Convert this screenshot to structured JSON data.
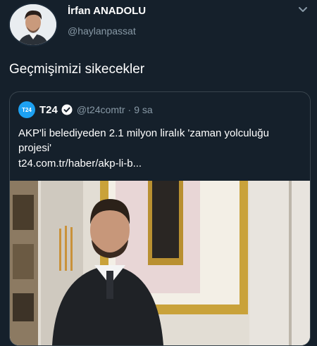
{
  "tweet": {
    "author_name": "İrfan ANADOLU",
    "author_handle": "@haylanpassat",
    "text": "Geçmişimizi sikecekler"
  },
  "quote": {
    "logo_text": "T24",
    "name": "T24",
    "handle": "@t24comtr",
    "separator": "·",
    "time": "9 sa",
    "text": "AKP'li belediyeden 2.1 milyon liralık 'zaman yolculuğu projesi'",
    "link": "t24.com.tr/haber/akp-li-b..."
  },
  "icons": {
    "menu": "chevron-down-icon",
    "verified": "verified-badge-icon"
  },
  "colors": {
    "background": "#15202b",
    "border": "#38444d",
    "secondary_text": "#8899a6",
    "accent": "#1da1f2"
  }
}
